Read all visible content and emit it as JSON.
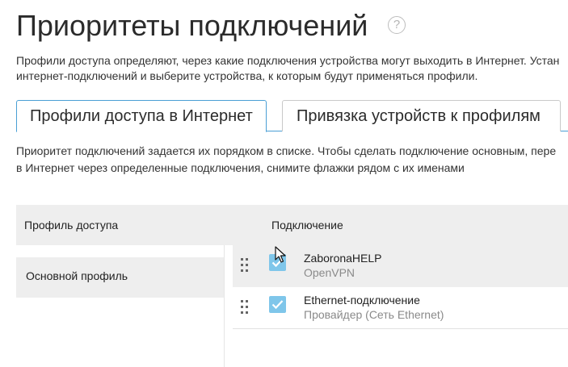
{
  "page": {
    "title": "Приоритеты подключений",
    "help_icon": "question-circle-icon",
    "description_line1": "Профили доступа определяют, через какие подключения устройства могут выходить в Интернет. Устан",
    "description_line2": "интернет-подключений и выберите устройства, к которым будут применяться профили."
  },
  "tabs": [
    {
      "label": "Профили доступа в Интернет",
      "active": true
    },
    {
      "label": "Привязка устройств к профилям",
      "active": false
    }
  ],
  "tab_content": {
    "description_line1": "Приоритет подключений задается их порядком в списке. Чтобы сделать подключение основным, пере",
    "description_line2": "в Интернет через определенные подключения, снимите флажки рядом с их именами"
  },
  "table": {
    "headers": {
      "profile": "Профиль доступа",
      "connection": "Подключение"
    },
    "profile_name": "Основной профиль",
    "connections": [
      {
        "name": "ZaboronaHELP",
        "type": "OpenVPN",
        "checked": true
      },
      {
        "name": "Ethernet-подключение",
        "type": "Провайдер (Сеть Ethernet)",
        "checked": true
      }
    ]
  },
  "colors": {
    "accent": "#4a9fd5",
    "checkbox": "#7fc6ea",
    "row_bg": "#eeeeee"
  }
}
